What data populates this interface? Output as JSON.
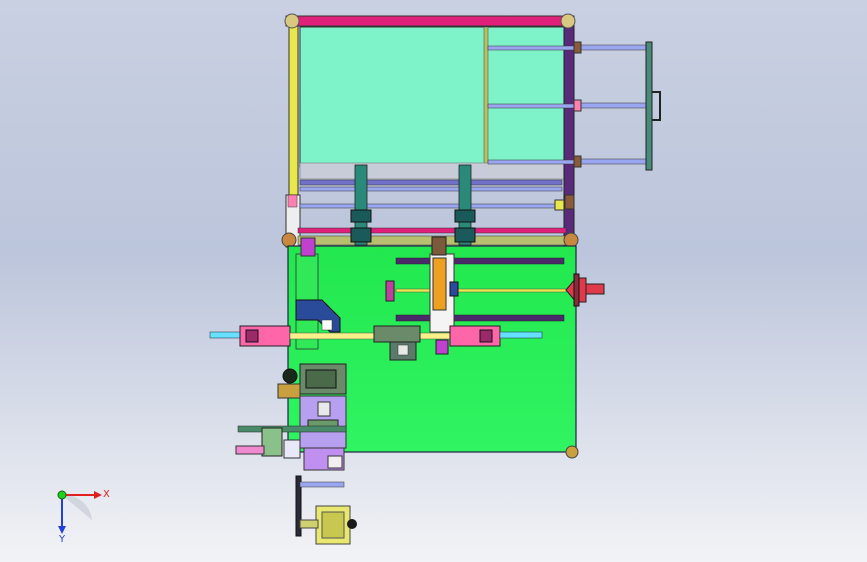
{
  "viewport": {
    "background_top": "#c8cfe2",
    "background_bottom": "#f3f4f7"
  },
  "colors": {
    "frame_top_rail": "#e0207a",
    "frame_left_rail": "#e8e84a",
    "frame_right_rail": "#5a2a7a",
    "hopper_panel": "#7ef2c8",
    "base_plate": "#2cf05a",
    "slide_rods": "#9aa6f0",
    "stepper_motor": "#6a8a6a",
    "cylinder_body": "#ff66aa",
    "cylinder_rod": "#66e0ff",
    "handwheel": "#e03a4a",
    "support_bar": "#f0a020"
  },
  "axis_triad": {
    "x_label": "X",
    "y_label": "Y",
    "x_color": "#e02020",
    "y_color": "#2040e0",
    "origin_color": "#20d020"
  }
}
